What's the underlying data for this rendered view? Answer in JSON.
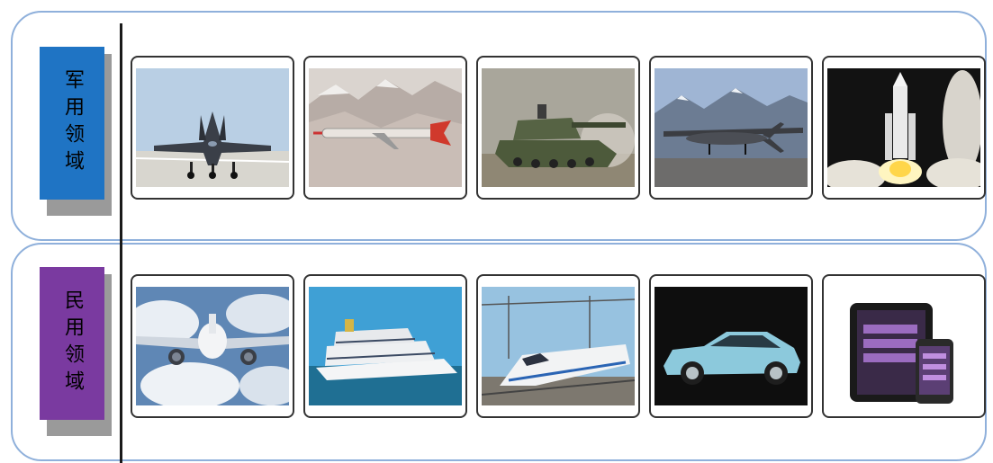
{
  "sections": [
    {
      "label": "军用领域",
      "color": "#1f74c4",
      "items": [
        "fighter-jet",
        "cruise-missile",
        "tank",
        "drone",
        "rocket-launch"
      ]
    },
    {
      "label": "民用领域",
      "color": "#7a3aa0",
      "items": [
        "airliner",
        "cruise-ship",
        "high-speed-train",
        "car",
        "tablet-phone"
      ]
    }
  ]
}
